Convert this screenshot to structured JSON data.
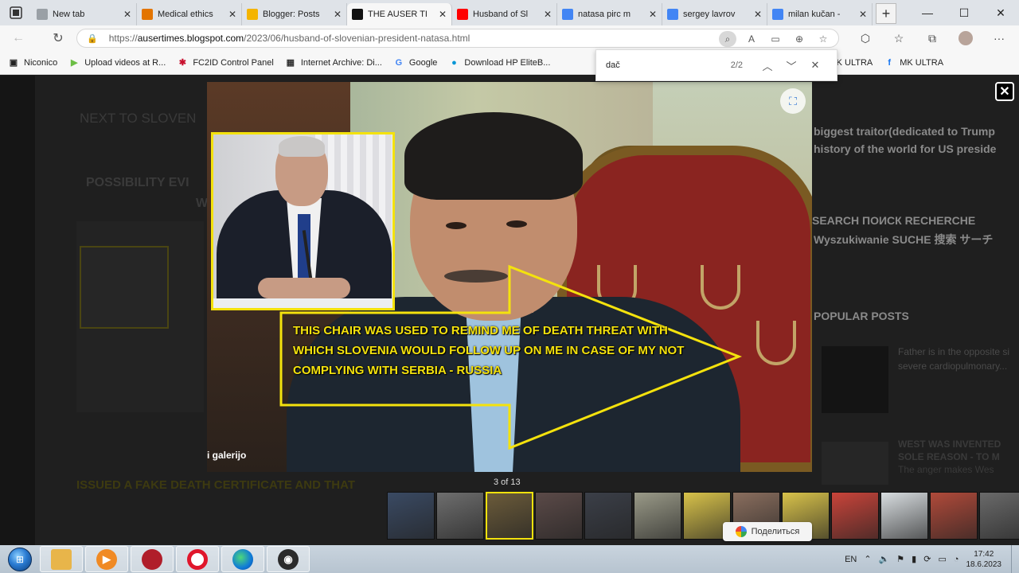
{
  "tabs": [
    {
      "label": "New tab",
      "icon": "new-tab-icon",
      "color": "#9aa0a6"
    },
    {
      "label": "Medical ethics",
      "icon": "grid-icon",
      "color": "#e37400"
    },
    {
      "label": "Blogger: Posts",
      "icon": "blogger-icon",
      "color": "#f4b400"
    },
    {
      "label": "THE AUSER TI",
      "icon": "auser-icon",
      "color": "#111111",
      "active": true
    },
    {
      "label": "Husband of Sl",
      "icon": "youtube-icon",
      "color": "#ff0000"
    },
    {
      "label": "natasa pirc m",
      "icon": "google-icon",
      "color": "#4285f4"
    },
    {
      "label": "sergey lavrov",
      "icon": "google-icon",
      "color": "#4285f4"
    },
    {
      "label": "milan kučan -",
      "icon": "google-icon",
      "color": "#4285f4"
    }
  ],
  "address": {
    "scheme": "https://",
    "host": "ausertimes.blogspot.com",
    "path": "/2023/06/husband-of-slovenian-president-natasa.html"
  },
  "bookmarks": [
    {
      "label": "Niconico",
      "icon": "niconico-icon"
    },
    {
      "label": "Upload videos at R...",
      "icon": "rumble-icon"
    },
    {
      "label": "FC2ID Control Panel",
      "icon": "fc2-icon"
    },
    {
      "label": "Internet Archive: Di...",
      "icon": "archive-icon"
    },
    {
      "label": "Google",
      "icon": "google-icon"
    },
    {
      "label": "Download HP EliteB...",
      "icon": "hp-icon"
    },
    {
      "label": "MK ULTRA",
      "icon": "folder-icon"
    },
    {
      "label": "MK ULTRA",
      "icon": "facebook-icon"
    }
  ],
  "find": {
    "query": "dač",
    "count": "2/2"
  },
  "page": {
    "heading1": "NEXT TO SLOVEN",
    "heading2": "POSSIBILITY EVI",
    "heading2b": "W",
    "right1": "biggest traitor(dedicated to Trump",
    "right2": "history of the world for US preside",
    "search_title": "SEARCH ПОИСК RECHERCHE",
    "search_sub": "Wyszukiwanie SUCHE 搜索 サーチ",
    "popular": "POPULAR POSTS",
    "post1a": "Father is in the opposite si",
    "post1b": "severe cardiopulmonary...",
    "post2a": "WEST WAS INVENTED",
    "post2b": "SOLE REASON - TO M",
    "post2c": "The anger makes Wes",
    "bottom_heading": "ISSUED A FAKE DEATH CERTIFICATE AND THAT"
  },
  "lightbox": {
    "caption": "THIS CHAIR WAS USED TO REMIND ME OF DEATH THREAT WITH WHICH SLOVENIA WOULD FOLLOW UP ON ME IN CASE OF MY NOT COMPLYING WITH SERBIA - RUSSIA",
    "gallery_label": "i galerijo",
    "counter": "3 of 13",
    "share_label": "Поделиться",
    "accent": "#f4e20d"
  },
  "film_colors": [
    "#3a4a63",
    "#6e6e6e",
    "#6b5b3a",
    "#5b4a48",
    "#3b3f48",
    "#9a9a88",
    "#d8c24a",
    "#8a6e5e",
    "#d8c24a",
    "#c9443a",
    "#d8dde0",
    "#b04a3a",
    "#6a6a6a"
  ],
  "taskbar": {
    "lang": "EN",
    "time": "17:42",
    "date": "18.6.2023"
  }
}
